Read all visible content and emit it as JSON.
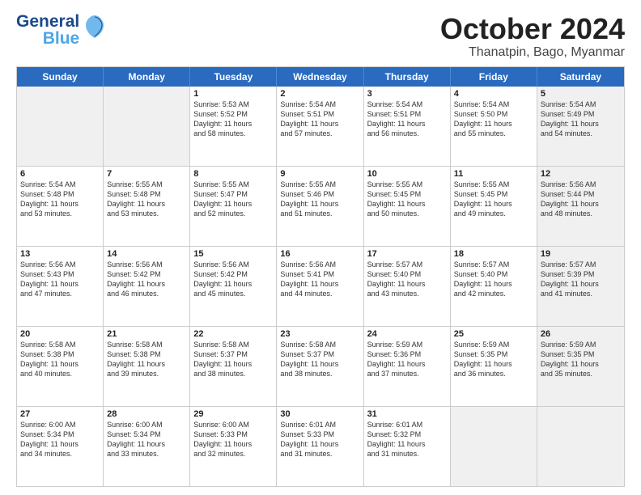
{
  "logo": {
    "line1": "General",
    "line2": "Blue"
  },
  "title": "October 2024",
  "location": "Thanatpin, Bago, Myanmar",
  "header_days": [
    "Sunday",
    "Monday",
    "Tuesday",
    "Wednesday",
    "Thursday",
    "Friday",
    "Saturday"
  ],
  "weeks": [
    [
      {
        "day": "",
        "info": "",
        "shaded": true
      },
      {
        "day": "",
        "info": "",
        "shaded": true
      },
      {
        "day": "1",
        "info": "Sunrise: 5:53 AM\nSunset: 5:52 PM\nDaylight: 11 hours\nand 58 minutes."
      },
      {
        "day": "2",
        "info": "Sunrise: 5:54 AM\nSunset: 5:51 PM\nDaylight: 11 hours\nand 57 minutes."
      },
      {
        "day": "3",
        "info": "Sunrise: 5:54 AM\nSunset: 5:51 PM\nDaylight: 11 hours\nand 56 minutes."
      },
      {
        "day": "4",
        "info": "Sunrise: 5:54 AM\nSunset: 5:50 PM\nDaylight: 11 hours\nand 55 minutes."
      },
      {
        "day": "5",
        "info": "Sunrise: 5:54 AM\nSunset: 5:49 PM\nDaylight: 11 hours\nand 54 minutes.",
        "shaded": true
      }
    ],
    [
      {
        "day": "6",
        "info": "Sunrise: 5:54 AM\nSunset: 5:48 PM\nDaylight: 11 hours\nand 53 minutes."
      },
      {
        "day": "7",
        "info": "Sunrise: 5:55 AM\nSunset: 5:48 PM\nDaylight: 11 hours\nand 53 minutes."
      },
      {
        "day": "8",
        "info": "Sunrise: 5:55 AM\nSunset: 5:47 PM\nDaylight: 11 hours\nand 52 minutes."
      },
      {
        "day": "9",
        "info": "Sunrise: 5:55 AM\nSunset: 5:46 PM\nDaylight: 11 hours\nand 51 minutes."
      },
      {
        "day": "10",
        "info": "Sunrise: 5:55 AM\nSunset: 5:45 PM\nDaylight: 11 hours\nand 50 minutes."
      },
      {
        "day": "11",
        "info": "Sunrise: 5:55 AM\nSunset: 5:45 PM\nDaylight: 11 hours\nand 49 minutes."
      },
      {
        "day": "12",
        "info": "Sunrise: 5:56 AM\nSunset: 5:44 PM\nDaylight: 11 hours\nand 48 minutes.",
        "shaded": true
      }
    ],
    [
      {
        "day": "13",
        "info": "Sunrise: 5:56 AM\nSunset: 5:43 PM\nDaylight: 11 hours\nand 47 minutes."
      },
      {
        "day": "14",
        "info": "Sunrise: 5:56 AM\nSunset: 5:42 PM\nDaylight: 11 hours\nand 46 minutes."
      },
      {
        "day": "15",
        "info": "Sunrise: 5:56 AM\nSunset: 5:42 PM\nDaylight: 11 hours\nand 45 minutes."
      },
      {
        "day": "16",
        "info": "Sunrise: 5:56 AM\nSunset: 5:41 PM\nDaylight: 11 hours\nand 44 minutes."
      },
      {
        "day": "17",
        "info": "Sunrise: 5:57 AM\nSunset: 5:40 PM\nDaylight: 11 hours\nand 43 minutes."
      },
      {
        "day": "18",
        "info": "Sunrise: 5:57 AM\nSunset: 5:40 PM\nDaylight: 11 hours\nand 42 minutes."
      },
      {
        "day": "19",
        "info": "Sunrise: 5:57 AM\nSunset: 5:39 PM\nDaylight: 11 hours\nand 41 minutes.",
        "shaded": true
      }
    ],
    [
      {
        "day": "20",
        "info": "Sunrise: 5:58 AM\nSunset: 5:38 PM\nDaylight: 11 hours\nand 40 minutes."
      },
      {
        "day": "21",
        "info": "Sunrise: 5:58 AM\nSunset: 5:38 PM\nDaylight: 11 hours\nand 39 minutes."
      },
      {
        "day": "22",
        "info": "Sunrise: 5:58 AM\nSunset: 5:37 PM\nDaylight: 11 hours\nand 38 minutes."
      },
      {
        "day": "23",
        "info": "Sunrise: 5:58 AM\nSunset: 5:37 PM\nDaylight: 11 hours\nand 38 minutes."
      },
      {
        "day": "24",
        "info": "Sunrise: 5:59 AM\nSunset: 5:36 PM\nDaylight: 11 hours\nand 37 minutes."
      },
      {
        "day": "25",
        "info": "Sunrise: 5:59 AM\nSunset: 5:35 PM\nDaylight: 11 hours\nand 36 minutes."
      },
      {
        "day": "26",
        "info": "Sunrise: 5:59 AM\nSunset: 5:35 PM\nDaylight: 11 hours\nand 35 minutes.",
        "shaded": true
      }
    ],
    [
      {
        "day": "27",
        "info": "Sunrise: 6:00 AM\nSunset: 5:34 PM\nDaylight: 11 hours\nand 34 minutes."
      },
      {
        "day": "28",
        "info": "Sunrise: 6:00 AM\nSunset: 5:34 PM\nDaylight: 11 hours\nand 33 minutes."
      },
      {
        "day": "29",
        "info": "Sunrise: 6:00 AM\nSunset: 5:33 PM\nDaylight: 11 hours\nand 32 minutes."
      },
      {
        "day": "30",
        "info": "Sunrise: 6:01 AM\nSunset: 5:33 PM\nDaylight: 11 hours\nand 31 minutes."
      },
      {
        "day": "31",
        "info": "Sunrise: 6:01 AM\nSunset: 5:32 PM\nDaylight: 11 hours\nand 31 minutes."
      },
      {
        "day": "",
        "info": "",
        "shaded": true
      },
      {
        "day": "",
        "info": "",
        "shaded": true
      }
    ]
  ]
}
